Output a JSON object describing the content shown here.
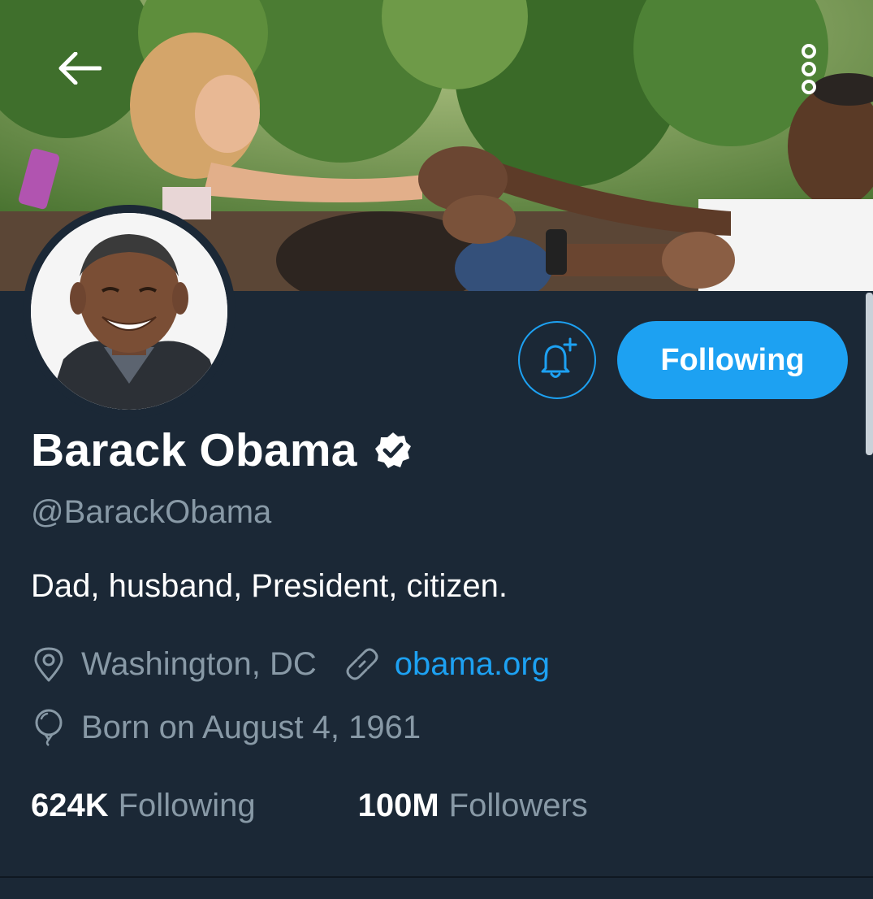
{
  "header": {
    "back_icon": "arrow-left-icon",
    "more_icon": "vertical-ellipsis-icon"
  },
  "profile": {
    "name": "Barack Obama",
    "verified": true,
    "handle": "@BarackObama",
    "bio": "Dad, husband, President, citizen.",
    "location": "Washington, DC",
    "website": "obama.org",
    "birthday": "Born on August 4, 1961"
  },
  "actions": {
    "notify_icon": "bell-plus-icon",
    "follow_label": "Following"
  },
  "stats": {
    "following_count": "624K",
    "following_label": "Following",
    "followers_count": "100M",
    "followers_label": "Followers"
  },
  "colors": {
    "background": "#1b2836",
    "accent": "#1da1f2",
    "secondary_text": "#8899a6",
    "primary_text": "#ffffff"
  }
}
